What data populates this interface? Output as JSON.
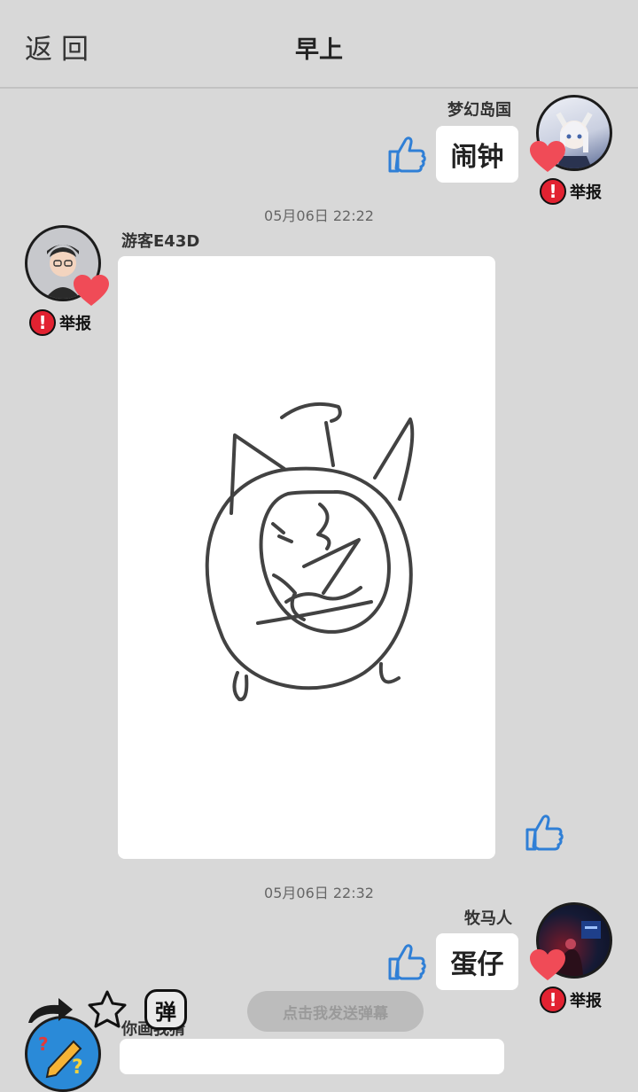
{
  "header": {
    "back_label": "返回",
    "title": "早上"
  },
  "messages": [
    {
      "user": "梦幻岛国",
      "text": "闹钟",
      "report": "举报",
      "side": "right"
    },
    {
      "time": "05月06日  22:22",
      "user": "游客E43D",
      "report": "举报",
      "side": "left",
      "type": "drawing"
    },
    {
      "time": "05月06日  22:32",
      "user": "牧马人",
      "text": "蛋仔",
      "report": "举报",
      "side": "right"
    }
  ],
  "bottom": {
    "user": "你画我猜",
    "danmu_button": "点击我发送弹幕",
    "danmu_icon_char": "弹"
  },
  "icons": [
    "thumbs-up-icon",
    "heart-icon",
    "report-icon",
    "share-icon",
    "star-icon",
    "danmu-icon"
  ],
  "colors": {
    "thumb": "#2f7fd6",
    "heart": "#f04b57",
    "report": "#e22231",
    "background": "#d8d8d8"
  }
}
